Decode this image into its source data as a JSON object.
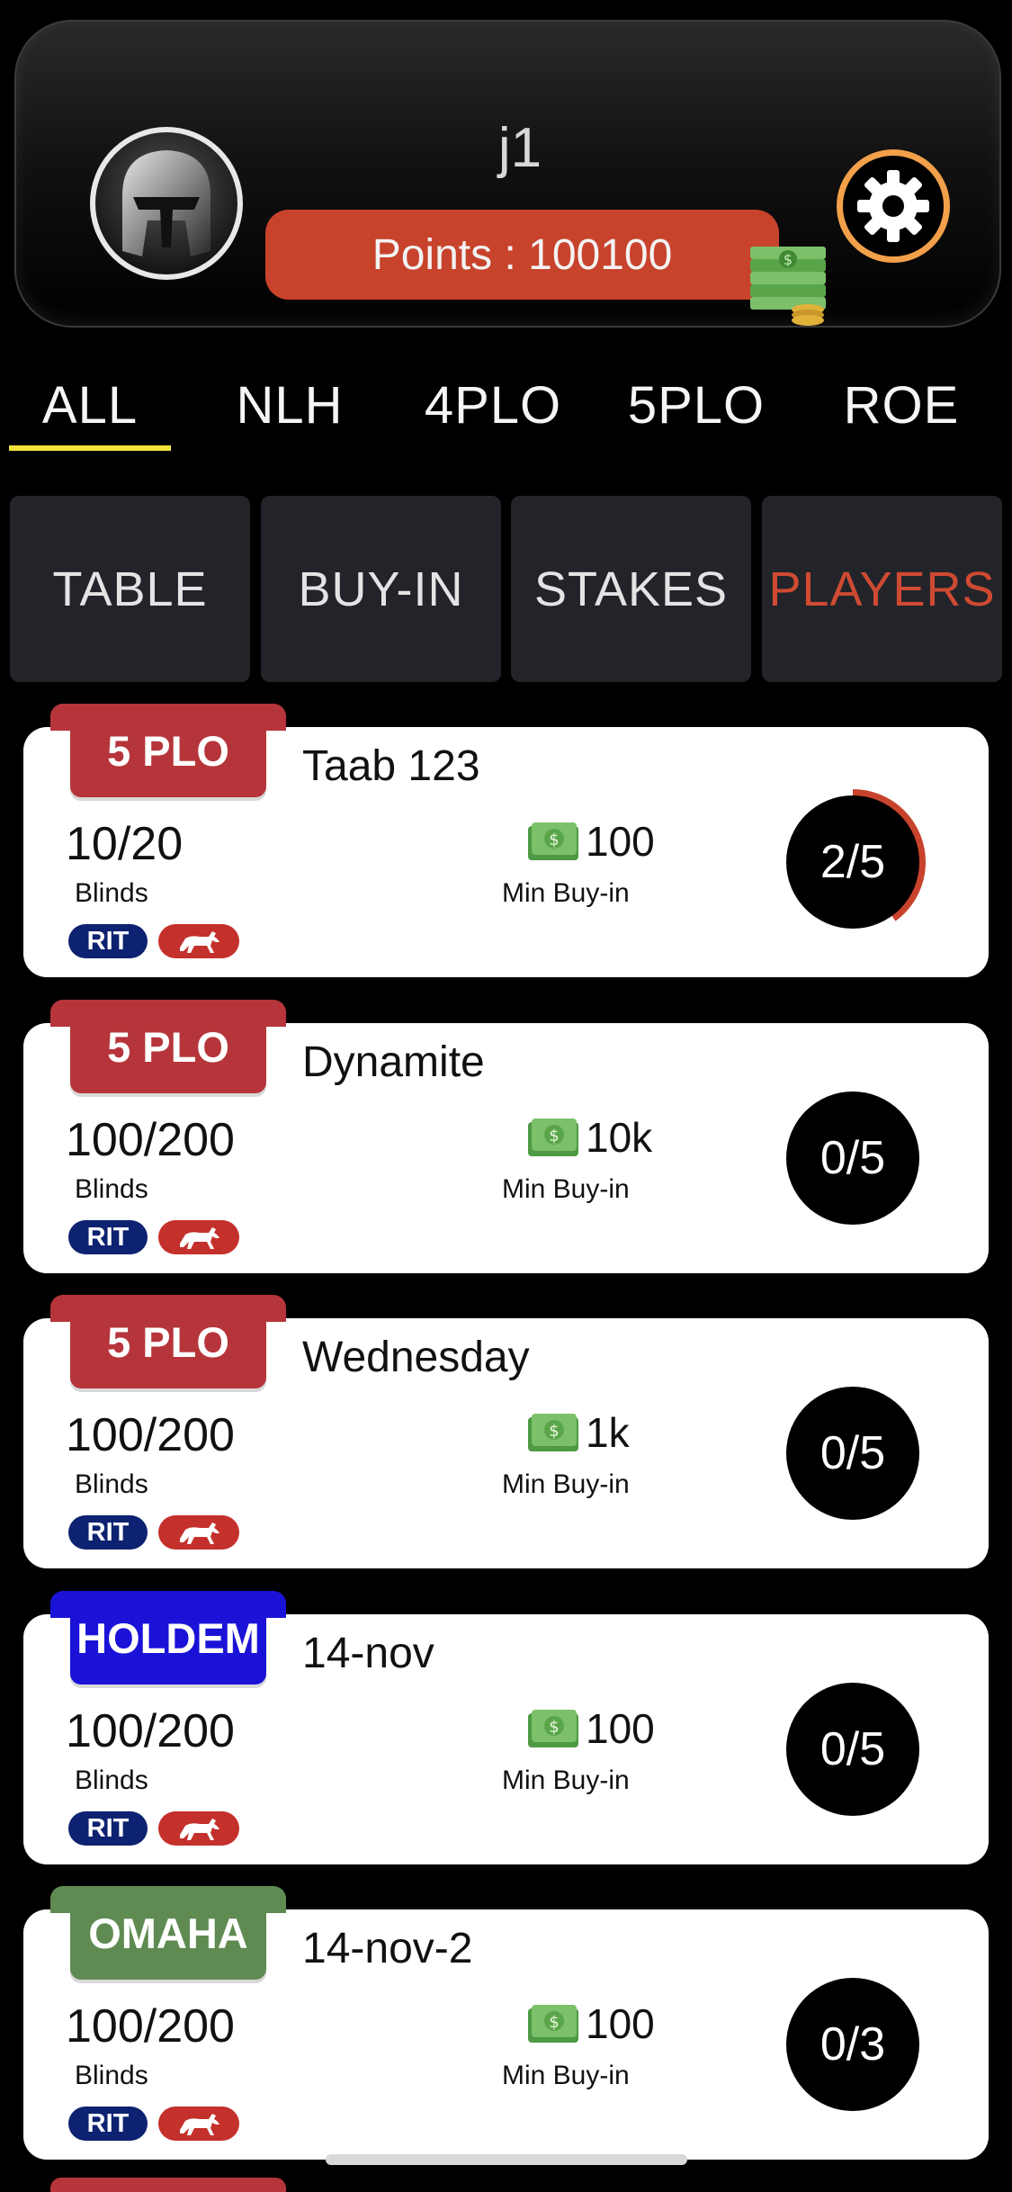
{
  "header": {
    "username": "j1",
    "points_label": "Points : 100100"
  },
  "game_tabs": [
    {
      "label": "ALL",
      "active": true
    },
    {
      "label": "NLH",
      "active": false
    },
    {
      "label": "4PLO",
      "active": false
    },
    {
      "label": "5PLO",
      "active": false
    },
    {
      "label": "ROE",
      "active": false
    }
  ],
  "sort_buttons": [
    {
      "label": "TABLE",
      "active": false
    },
    {
      "label": "BUY-IN",
      "active": false
    },
    {
      "label": "STAKES",
      "active": false
    },
    {
      "label": "PLAYERS",
      "active": true
    }
  ],
  "labels": {
    "blinds": "Blinds",
    "min_buyin": "Min Buy-in",
    "rit": "RIT"
  },
  "tables": [
    {
      "game": "5 PLO",
      "game_color": "#b6353a",
      "name": "Taab 123",
      "blinds": "10/20",
      "buyin": "100",
      "seats": "2/5",
      "fill": 0.4
    },
    {
      "game": "5 PLO",
      "game_color": "#b6353a",
      "name": "Dynamite",
      "blinds": "100/200",
      "buyin": "10k",
      "seats": "0/5",
      "fill": 0
    },
    {
      "game": "5 PLO",
      "game_color": "#b6353a",
      "name": "Wednesday",
      "blinds": "100/200",
      "buyin": "1k",
      "seats": "0/5",
      "fill": 0
    },
    {
      "game": "HOLDEM",
      "game_color": "#1a12d6",
      "name": "14-nov",
      "blinds": "100/200",
      "buyin": "100",
      "seats": "0/5",
      "fill": 0
    },
    {
      "game": "OMAHA",
      "game_color": "#5f8b52",
      "name": "14-nov-2",
      "blinds": "100/200",
      "buyin": "100",
      "seats": "0/3",
      "fill": 0
    }
  ],
  "colors": {
    "accent_red": "#c8432c",
    "gear_ring": "#f2a04a",
    "tab_underline": "#f2e23c",
    "seat_fill": "#c8432c"
  }
}
